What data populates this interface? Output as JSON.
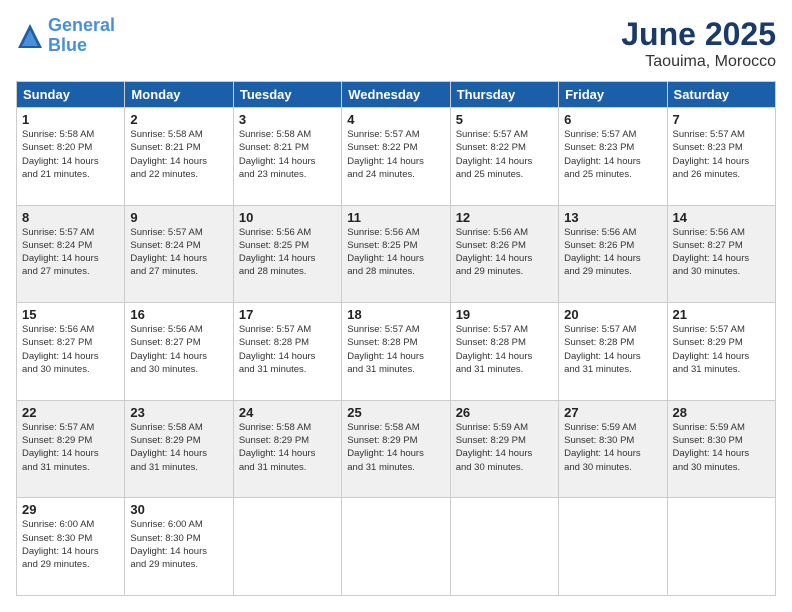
{
  "header": {
    "logo_line1": "General",
    "logo_line2": "Blue",
    "month": "June 2025",
    "location": "Taouima, Morocco"
  },
  "weekdays": [
    "Sunday",
    "Monday",
    "Tuesday",
    "Wednesday",
    "Thursday",
    "Friday",
    "Saturday"
  ],
  "weeks": [
    [
      {
        "day": "1",
        "info": "Sunrise: 5:58 AM\nSunset: 8:20 PM\nDaylight: 14 hours\nand 21 minutes."
      },
      {
        "day": "2",
        "info": "Sunrise: 5:58 AM\nSunset: 8:21 PM\nDaylight: 14 hours\nand 22 minutes."
      },
      {
        "day": "3",
        "info": "Sunrise: 5:58 AM\nSunset: 8:21 PM\nDaylight: 14 hours\nand 23 minutes."
      },
      {
        "day": "4",
        "info": "Sunrise: 5:57 AM\nSunset: 8:22 PM\nDaylight: 14 hours\nand 24 minutes."
      },
      {
        "day": "5",
        "info": "Sunrise: 5:57 AM\nSunset: 8:22 PM\nDaylight: 14 hours\nand 25 minutes."
      },
      {
        "day": "6",
        "info": "Sunrise: 5:57 AM\nSunset: 8:23 PM\nDaylight: 14 hours\nand 25 minutes."
      },
      {
        "day": "7",
        "info": "Sunrise: 5:57 AM\nSunset: 8:23 PM\nDaylight: 14 hours\nand 26 minutes."
      }
    ],
    [
      {
        "day": "8",
        "info": "Sunrise: 5:57 AM\nSunset: 8:24 PM\nDaylight: 14 hours\nand 27 minutes."
      },
      {
        "day": "9",
        "info": "Sunrise: 5:57 AM\nSunset: 8:24 PM\nDaylight: 14 hours\nand 27 minutes."
      },
      {
        "day": "10",
        "info": "Sunrise: 5:56 AM\nSunset: 8:25 PM\nDaylight: 14 hours\nand 28 minutes."
      },
      {
        "day": "11",
        "info": "Sunrise: 5:56 AM\nSunset: 8:25 PM\nDaylight: 14 hours\nand 28 minutes."
      },
      {
        "day": "12",
        "info": "Sunrise: 5:56 AM\nSunset: 8:26 PM\nDaylight: 14 hours\nand 29 minutes."
      },
      {
        "day": "13",
        "info": "Sunrise: 5:56 AM\nSunset: 8:26 PM\nDaylight: 14 hours\nand 29 minutes."
      },
      {
        "day": "14",
        "info": "Sunrise: 5:56 AM\nSunset: 8:27 PM\nDaylight: 14 hours\nand 30 minutes."
      }
    ],
    [
      {
        "day": "15",
        "info": "Sunrise: 5:56 AM\nSunset: 8:27 PM\nDaylight: 14 hours\nand 30 minutes."
      },
      {
        "day": "16",
        "info": "Sunrise: 5:56 AM\nSunset: 8:27 PM\nDaylight: 14 hours\nand 30 minutes."
      },
      {
        "day": "17",
        "info": "Sunrise: 5:57 AM\nSunset: 8:28 PM\nDaylight: 14 hours\nand 31 minutes."
      },
      {
        "day": "18",
        "info": "Sunrise: 5:57 AM\nSunset: 8:28 PM\nDaylight: 14 hours\nand 31 minutes."
      },
      {
        "day": "19",
        "info": "Sunrise: 5:57 AM\nSunset: 8:28 PM\nDaylight: 14 hours\nand 31 minutes."
      },
      {
        "day": "20",
        "info": "Sunrise: 5:57 AM\nSunset: 8:28 PM\nDaylight: 14 hours\nand 31 minutes."
      },
      {
        "day": "21",
        "info": "Sunrise: 5:57 AM\nSunset: 8:29 PM\nDaylight: 14 hours\nand 31 minutes."
      }
    ],
    [
      {
        "day": "22",
        "info": "Sunrise: 5:57 AM\nSunset: 8:29 PM\nDaylight: 14 hours\nand 31 minutes."
      },
      {
        "day": "23",
        "info": "Sunrise: 5:58 AM\nSunset: 8:29 PM\nDaylight: 14 hours\nand 31 minutes."
      },
      {
        "day": "24",
        "info": "Sunrise: 5:58 AM\nSunset: 8:29 PM\nDaylight: 14 hours\nand 31 minutes."
      },
      {
        "day": "25",
        "info": "Sunrise: 5:58 AM\nSunset: 8:29 PM\nDaylight: 14 hours\nand 31 minutes."
      },
      {
        "day": "26",
        "info": "Sunrise: 5:59 AM\nSunset: 8:29 PM\nDaylight: 14 hours\nand 30 minutes."
      },
      {
        "day": "27",
        "info": "Sunrise: 5:59 AM\nSunset: 8:30 PM\nDaylight: 14 hours\nand 30 minutes."
      },
      {
        "day": "28",
        "info": "Sunrise: 5:59 AM\nSunset: 8:30 PM\nDaylight: 14 hours\nand 30 minutes."
      }
    ],
    [
      {
        "day": "29",
        "info": "Sunrise: 6:00 AM\nSunset: 8:30 PM\nDaylight: 14 hours\nand 29 minutes."
      },
      {
        "day": "30",
        "info": "Sunrise: 6:00 AM\nSunset: 8:30 PM\nDaylight: 14 hours\nand 29 minutes."
      },
      {
        "day": "",
        "info": ""
      },
      {
        "day": "",
        "info": ""
      },
      {
        "day": "",
        "info": ""
      },
      {
        "day": "",
        "info": ""
      },
      {
        "day": "",
        "info": ""
      }
    ]
  ]
}
